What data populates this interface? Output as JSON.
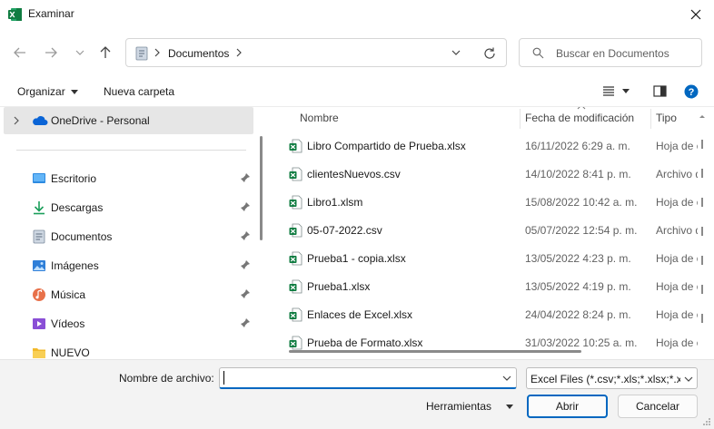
{
  "window": {
    "title": "Examinar",
    "app_icon": "excel-icon",
    "close_icon": "close-icon"
  },
  "address": {
    "path": "Documentos",
    "search_placeholder": "Buscar en Documentos"
  },
  "toolbar": {
    "organize_label": "Organizar",
    "new_folder_label": "Nueva carpeta"
  },
  "nav": {
    "onedrive_label": "OneDrive - Personal",
    "items": [
      {
        "label": "Escritorio",
        "icon": "desktop-icon",
        "pinned": true
      },
      {
        "label": "Descargas",
        "icon": "download-icon",
        "pinned": true
      },
      {
        "label": "Documentos",
        "icon": "documents-icon",
        "pinned": true
      },
      {
        "label": "Imágenes",
        "icon": "pictures-icon",
        "pinned": true
      },
      {
        "label": "Música",
        "icon": "music-icon",
        "pinned": true
      },
      {
        "label": "Vídeos",
        "icon": "videos-icon",
        "pinned": true
      },
      {
        "label": "NUEVO",
        "icon": "folder-icon",
        "pinned": false
      }
    ]
  },
  "files": {
    "columns": {
      "name": "Nombre",
      "date": "Fecha de modificación",
      "type": "Tipo"
    },
    "rows": [
      {
        "name": "Libro Compartido de Prueba.xlsx",
        "date": "16/11/2022 6:29 a. m.",
        "type": "Hoja de cálculo"
      },
      {
        "name": "clientesNuevos.csv",
        "date": "14/10/2022 8:41 p. m.",
        "type": "Archivo de valores"
      },
      {
        "name": "Libro1.xlsm",
        "date": "15/08/2022 10:42 a. m.",
        "type": "Hoja de cálculo"
      },
      {
        "name": "05-07-2022.csv",
        "date": "05/07/2022 12:54 p. m.",
        "type": "Archivo de valores"
      },
      {
        "name": "Prueba1 - copia.xlsx",
        "date": "13/05/2022 4:23 p. m.",
        "type": "Hoja de cálculo"
      },
      {
        "name": "Prueba1.xlsx",
        "date": "13/05/2022 4:19 p. m.",
        "type": "Hoja de cálculo"
      },
      {
        "name": "Enlaces de Excel.xlsx",
        "date": "24/04/2022 8:24 p. m.",
        "type": "Hoja de cálculo"
      },
      {
        "name": "Prueba de Formato.xlsx",
        "date": "31/03/2022 10:25 a. m.",
        "type": "Hoja de cálculo"
      }
    ]
  },
  "footer": {
    "filename_label": "Nombre de archivo:",
    "filename_value": "",
    "filter_value": "Excel Files (*.csv;*.xls;*.xlsx;*.xlsm)",
    "tools_label": "Herramientas",
    "open_label": "Abrir",
    "cancel_label": "Cancelar"
  },
  "colors": {
    "accent": "#0067c0",
    "excel_green": "#107c41",
    "selected_bg": "#e6e6e6"
  }
}
